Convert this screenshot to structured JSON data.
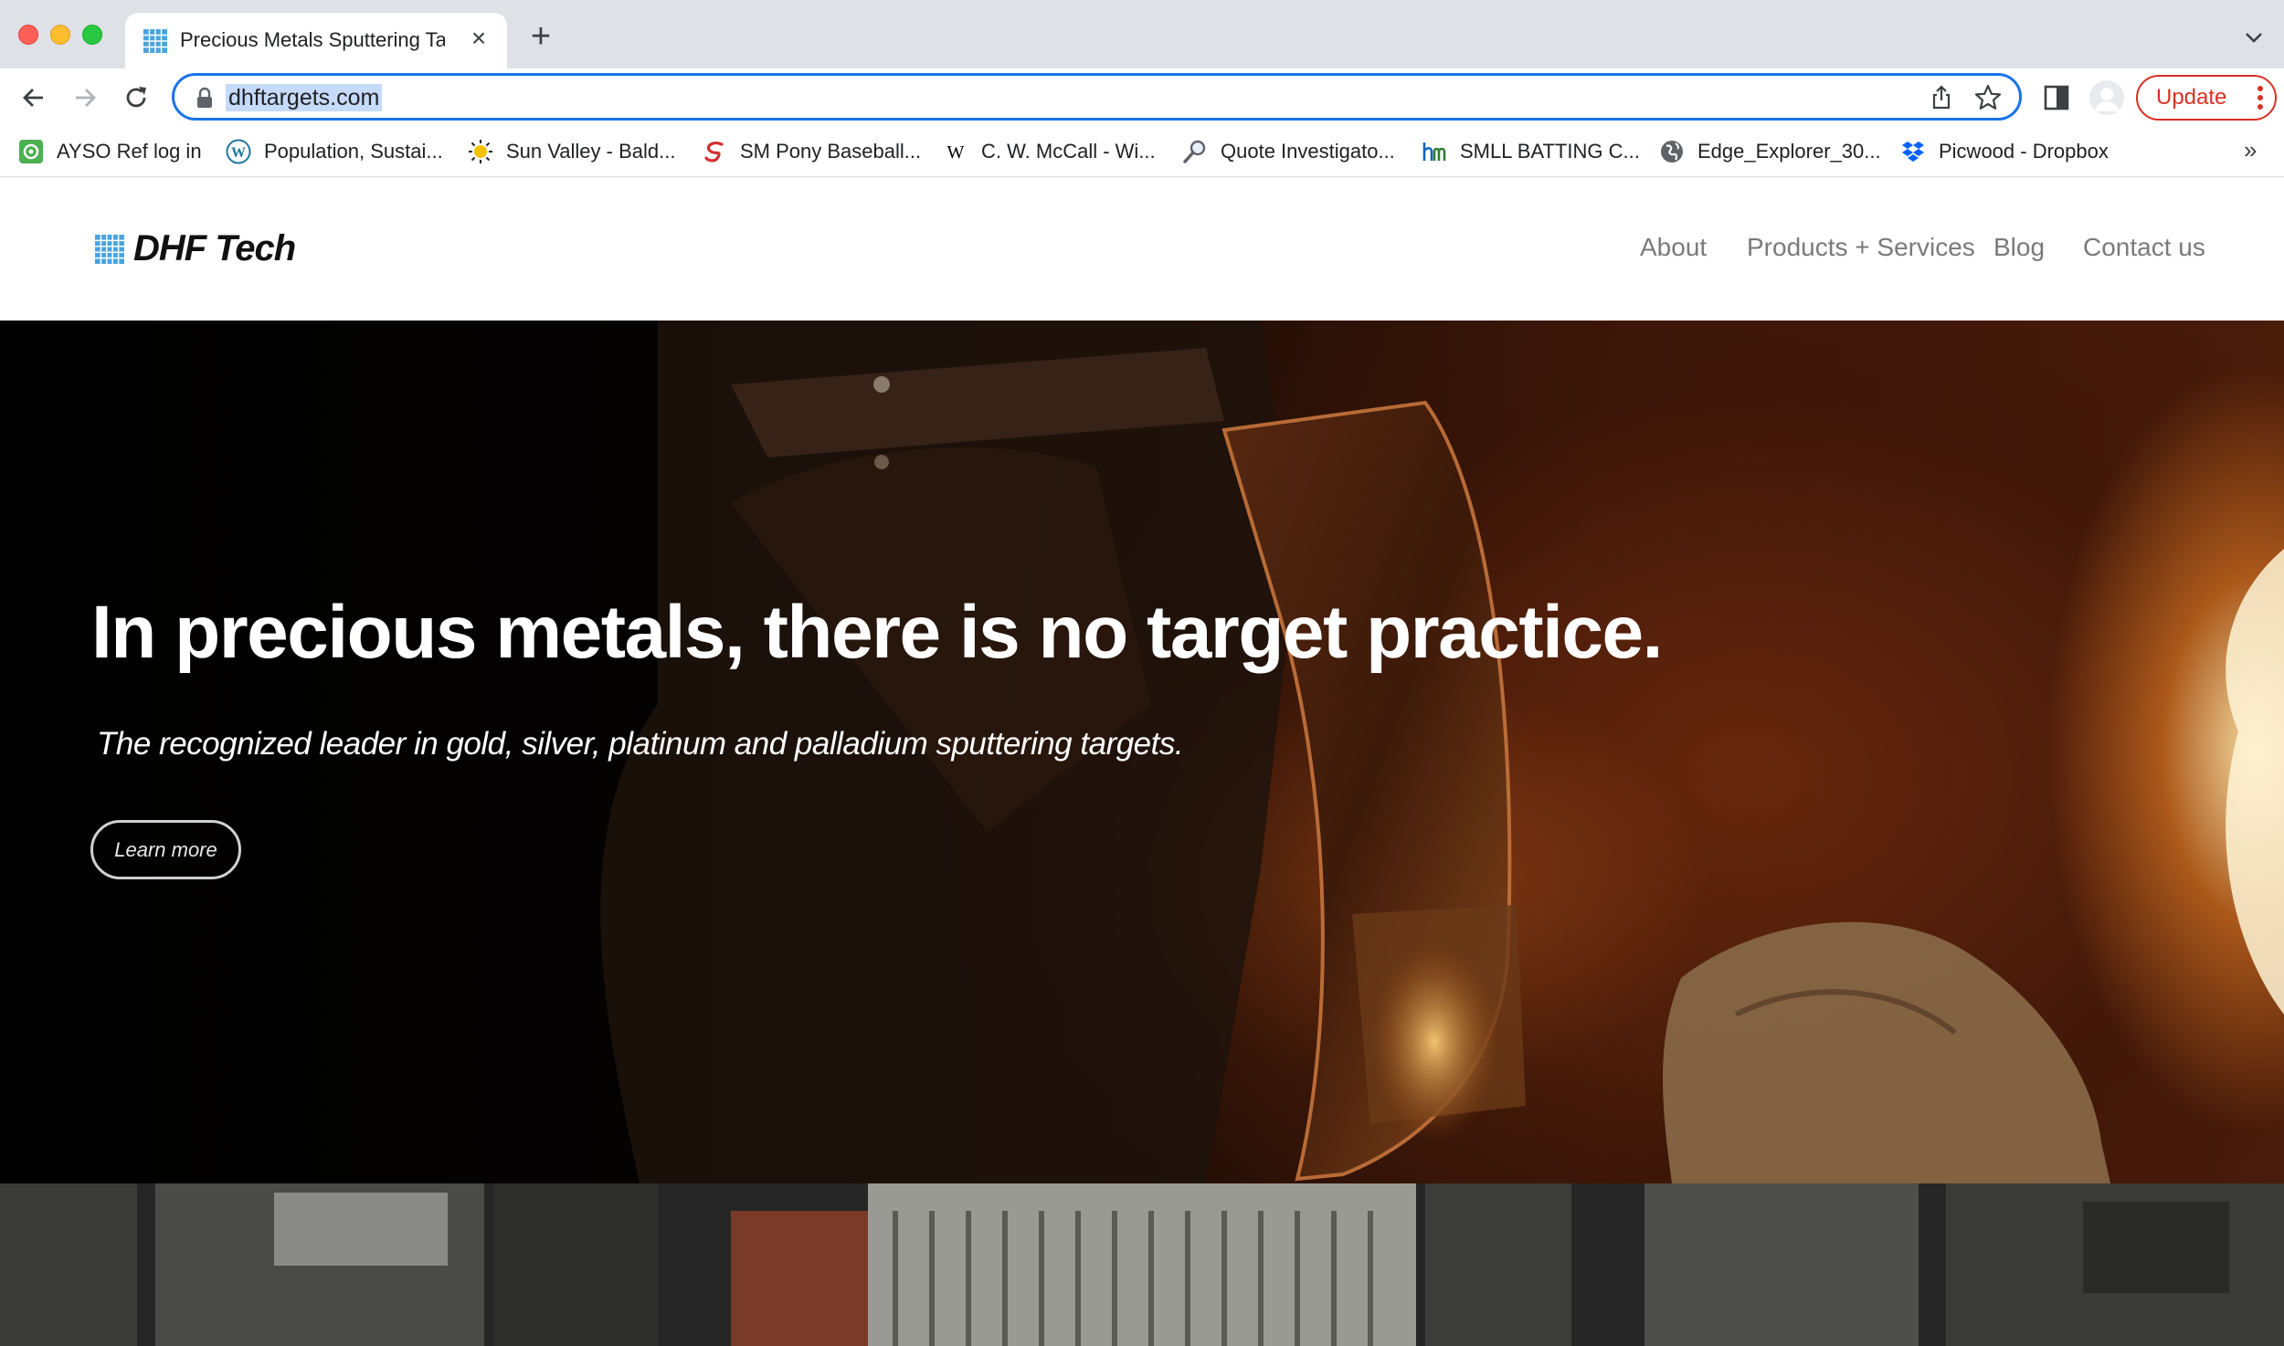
{
  "browser": {
    "tab": {
      "title": "Precious Metals Sputtering Targets | DHF Tech"
    },
    "url": "dhftargets.com",
    "update_label": "Update"
  },
  "bookmarks": [
    {
      "label": "AYSO Ref log in",
      "icon": "ayso-icon",
      "color": "#4caf50"
    },
    {
      "label": "Population, Sustai...",
      "icon": "wordpress-icon",
      "color": "#21759b"
    },
    {
      "label": "Sun Valley - Bald...",
      "icon": "sun-valley-icon",
      "color": "#c9a800"
    },
    {
      "label": "SM Pony Baseball...",
      "icon": "pony-icon",
      "color": "#d32f2f"
    },
    {
      "label": "C. W. McCall - Wi...",
      "icon": "wikipedia-icon",
      "color": "#000000"
    },
    {
      "label": "Quote Investigato...",
      "icon": "magnifier-icon",
      "color": "#5f6368"
    },
    {
      "label": "SMLL BATTING C...",
      "icon": "hm-icon",
      "color": "#2e7d32"
    },
    {
      "label": "Edge_Explorer_30...",
      "icon": "globe-icon",
      "color": "#5f6368"
    },
    {
      "label": "Picwood - Dropbox",
      "icon": "dropbox-icon",
      "color": "#0061ff"
    }
  ],
  "site": {
    "brand": "DHF Tech",
    "nav": [
      "About",
      "Products + Services",
      "Blog",
      "Contact us"
    ],
    "hero": {
      "headline": "In precious metals, there is no target practice.",
      "subheadline": "The recognized leader in gold, silver, platinum and palladium sputtering targets.",
      "cta": "Learn more"
    }
  }
}
